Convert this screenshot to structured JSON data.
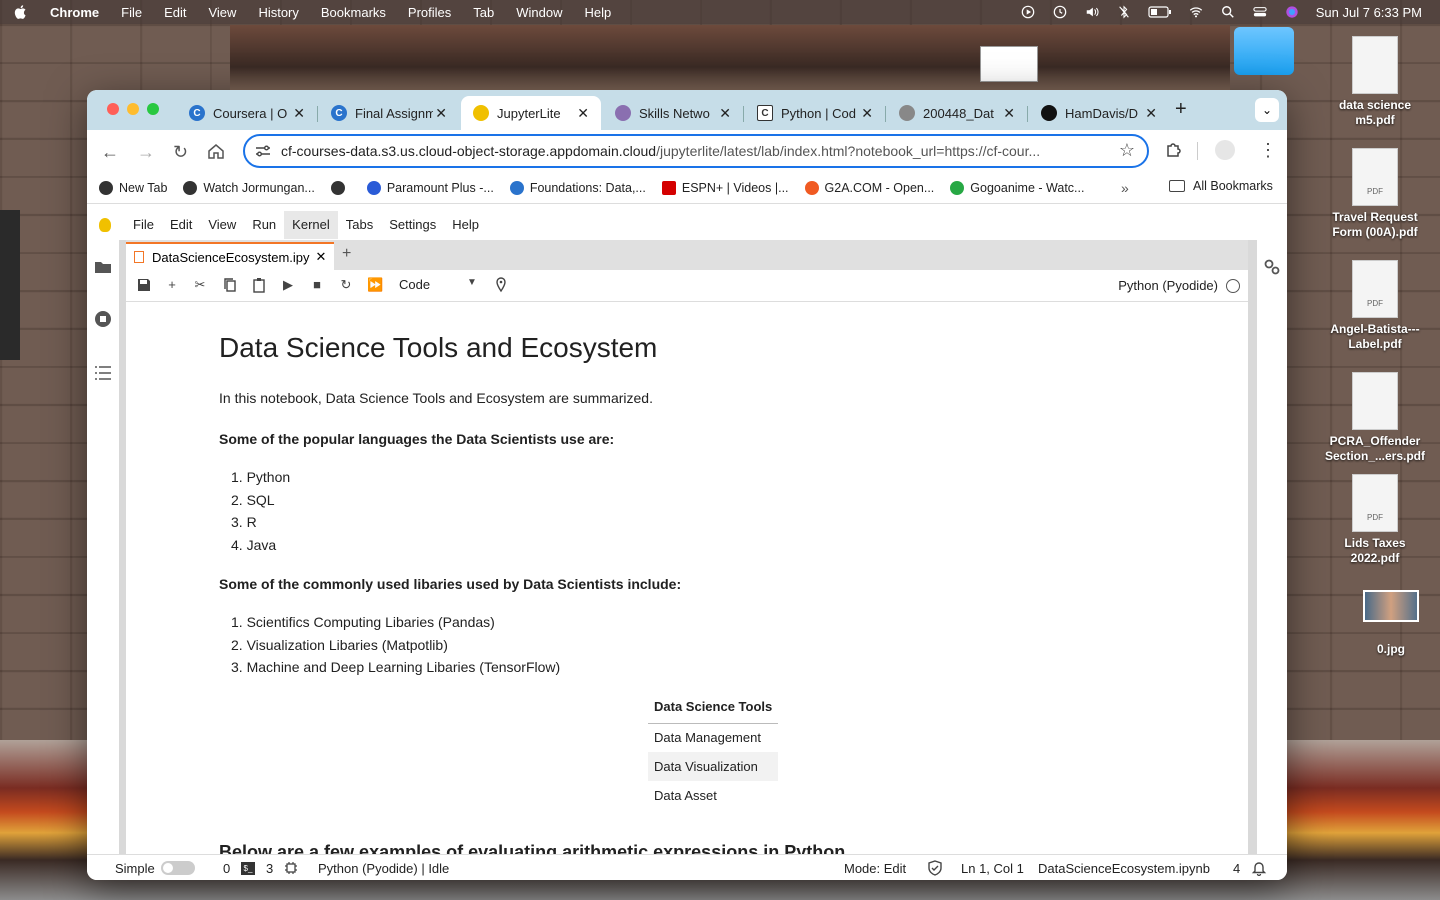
{
  "menubar": {
    "app": "Chrome",
    "items": [
      "File",
      "Edit",
      "View",
      "History",
      "Bookmarks",
      "Profiles",
      "Tab",
      "Window",
      "Help"
    ],
    "clock": "Sun Jul 7  6:33 PM"
  },
  "desktop": {
    "icons": [
      {
        "label": "data science m5.pdf",
        "kind": "doc"
      },
      {
        "label": "Travel Request Form (00A).pdf",
        "kind": "pdf"
      },
      {
        "label": "Angel-Batista---Label.pdf",
        "kind": "pdf"
      },
      {
        "label": "PCRA_Offender Section_...ers.pdf",
        "kind": "doc"
      },
      {
        "label": "Lids Taxes 2022.pdf",
        "kind": "pdf"
      },
      {
        "label": "0.jpg",
        "kind": "photo"
      }
    ],
    "pdf_badge": "PDF"
  },
  "browser": {
    "tabs": [
      {
        "label": "Coursera | O",
        "icon": "coursera-icon",
        "color": "#2a73cc"
      },
      {
        "label": "Final Assignm",
        "icon": "coursera-icon",
        "color": "#2a73cc"
      },
      {
        "label": "JupyterLite",
        "icon": "jupyterlite-icon",
        "color": "#f0c000",
        "active": true
      },
      {
        "label": "Skills Netwo",
        "icon": "skills-network-icon",
        "color": "#8a6fb0"
      },
      {
        "label": "Python | Cod",
        "icon": "code-icon",
        "color": "#333333"
      },
      {
        "label": "200448_Dat",
        "icon": "globe-icon",
        "color": "#777777"
      },
      {
        "label": "HamDavis/D",
        "icon": "github-icon",
        "color": "#111111"
      }
    ],
    "new_tab": "+",
    "url_host": "cf-courses-data.s3.us.cloud-object-storage.appdomain.cloud",
    "url_path": "/jupyterlite/latest/lab/index.html?notebook_url=https://cf-cour...",
    "bookmarks": [
      {
        "label": "New Tab",
        "color": "#333333"
      },
      {
        "label": "Watch Jormungan...",
        "color": "#333333"
      },
      {
        "label": "",
        "color": "#333333"
      },
      {
        "label": "Paramount Plus -...",
        "color": "#2a5bd7"
      },
      {
        "label": "Foundations: Data,...",
        "color": "#2a73cc"
      },
      {
        "label": "ESPN+ | Videos |...",
        "color": "#d40000"
      },
      {
        "label": "G2A.COM - Open...",
        "color": "#f05a22"
      },
      {
        "label": "Gogoanime - Watc...",
        "color": "#27a844"
      }
    ],
    "bookmarks_more": "»",
    "all_bookmarks": "All Bookmarks"
  },
  "jupyter": {
    "menus": [
      "File",
      "Edit",
      "View",
      "Run",
      "Kernel",
      "Tabs",
      "Settings",
      "Help"
    ],
    "active_menu": "Kernel",
    "notebook_tab": "DataScienceEcosystem.ipy",
    "cell_type": "Code",
    "kernel": "Python (Pyodide)",
    "notebook": {
      "title": "Data Science Tools and Ecosystem",
      "intro": "In this notebook, Data Science Tools and Ecosystem are summarized.",
      "languages_heading": "Some of the popular languages the Data Scientists use are:",
      "languages": [
        "Python",
        "SQL",
        "R",
        "Java"
      ],
      "libraries_heading": "Some of the commonly used libaries used by Data Scientists include:",
      "libraries": [
        "Scientifics Computing Libaries (Pandas)",
        "Visualization Libaries (Matpotlib)",
        "Machine and Deep Learning Libaries (TensorFlow)"
      ],
      "tools_table": {
        "header": "Data Science Tools",
        "rows": [
          "Data Management",
          "Data Visualization",
          "Data Asset"
        ]
      },
      "cut_heading": "Below are a few examples of evaluating arithmetic expressions in Python"
    },
    "status": {
      "mode_toggle": "Simple",
      "count_a": "0",
      "count_b": "3",
      "kernel_status": "Python (Pyodide) | Idle",
      "mode": "Mode: Edit",
      "position": "Ln 1, Col 1",
      "filename": "DataScienceEcosystem.ipynb",
      "notifications": "4"
    }
  }
}
